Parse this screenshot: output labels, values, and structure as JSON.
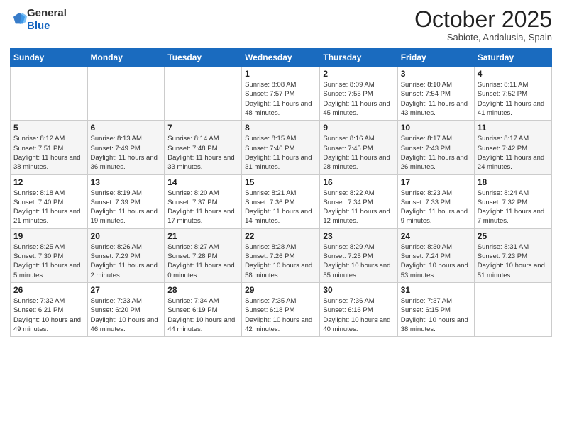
{
  "logo": {
    "general": "General",
    "blue": "Blue"
  },
  "title": "October 2025",
  "location": "Sabiote, Andalusia, Spain",
  "days_header": [
    "Sunday",
    "Monday",
    "Tuesday",
    "Wednesday",
    "Thursday",
    "Friday",
    "Saturday"
  ],
  "weeks": [
    [
      {
        "num": "",
        "info": ""
      },
      {
        "num": "",
        "info": ""
      },
      {
        "num": "",
        "info": ""
      },
      {
        "num": "1",
        "info": "Sunrise: 8:08 AM\nSunset: 7:57 PM\nDaylight: 11 hours\nand 48 minutes."
      },
      {
        "num": "2",
        "info": "Sunrise: 8:09 AM\nSunset: 7:55 PM\nDaylight: 11 hours\nand 45 minutes."
      },
      {
        "num": "3",
        "info": "Sunrise: 8:10 AM\nSunset: 7:54 PM\nDaylight: 11 hours\nand 43 minutes."
      },
      {
        "num": "4",
        "info": "Sunrise: 8:11 AM\nSunset: 7:52 PM\nDaylight: 11 hours\nand 41 minutes."
      }
    ],
    [
      {
        "num": "5",
        "info": "Sunrise: 8:12 AM\nSunset: 7:51 PM\nDaylight: 11 hours\nand 38 minutes."
      },
      {
        "num": "6",
        "info": "Sunrise: 8:13 AM\nSunset: 7:49 PM\nDaylight: 11 hours\nand 36 minutes."
      },
      {
        "num": "7",
        "info": "Sunrise: 8:14 AM\nSunset: 7:48 PM\nDaylight: 11 hours\nand 33 minutes."
      },
      {
        "num": "8",
        "info": "Sunrise: 8:15 AM\nSunset: 7:46 PM\nDaylight: 11 hours\nand 31 minutes."
      },
      {
        "num": "9",
        "info": "Sunrise: 8:16 AM\nSunset: 7:45 PM\nDaylight: 11 hours\nand 28 minutes."
      },
      {
        "num": "10",
        "info": "Sunrise: 8:17 AM\nSunset: 7:43 PM\nDaylight: 11 hours\nand 26 minutes."
      },
      {
        "num": "11",
        "info": "Sunrise: 8:17 AM\nSunset: 7:42 PM\nDaylight: 11 hours\nand 24 minutes."
      }
    ],
    [
      {
        "num": "12",
        "info": "Sunrise: 8:18 AM\nSunset: 7:40 PM\nDaylight: 11 hours\nand 21 minutes."
      },
      {
        "num": "13",
        "info": "Sunrise: 8:19 AM\nSunset: 7:39 PM\nDaylight: 11 hours\nand 19 minutes."
      },
      {
        "num": "14",
        "info": "Sunrise: 8:20 AM\nSunset: 7:37 PM\nDaylight: 11 hours\nand 17 minutes."
      },
      {
        "num": "15",
        "info": "Sunrise: 8:21 AM\nSunset: 7:36 PM\nDaylight: 11 hours\nand 14 minutes."
      },
      {
        "num": "16",
        "info": "Sunrise: 8:22 AM\nSunset: 7:34 PM\nDaylight: 11 hours\nand 12 minutes."
      },
      {
        "num": "17",
        "info": "Sunrise: 8:23 AM\nSunset: 7:33 PM\nDaylight: 11 hours\nand 9 minutes."
      },
      {
        "num": "18",
        "info": "Sunrise: 8:24 AM\nSunset: 7:32 PM\nDaylight: 11 hours\nand 7 minutes."
      }
    ],
    [
      {
        "num": "19",
        "info": "Sunrise: 8:25 AM\nSunset: 7:30 PM\nDaylight: 11 hours\nand 5 minutes."
      },
      {
        "num": "20",
        "info": "Sunrise: 8:26 AM\nSunset: 7:29 PM\nDaylight: 11 hours\nand 2 minutes."
      },
      {
        "num": "21",
        "info": "Sunrise: 8:27 AM\nSunset: 7:28 PM\nDaylight: 11 hours\nand 0 minutes."
      },
      {
        "num": "22",
        "info": "Sunrise: 8:28 AM\nSunset: 7:26 PM\nDaylight: 10 hours\nand 58 minutes."
      },
      {
        "num": "23",
        "info": "Sunrise: 8:29 AM\nSunset: 7:25 PM\nDaylight: 10 hours\nand 55 minutes."
      },
      {
        "num": "24",
        "info": "Sunrise: 8:30 AM\nSunset: 7:24 PM\nDaylight: 10 hours\nand 53 minutes."
      },
      {
        "num": "25",
        "info": "Sunrise: 8:31 AM\nSunset: 7:23 PM\nDaylight: 10 hours\nand 51 minutes."
      }
    ],
    [
      {
        "num": "26",
        "info": "Sunrise: 7:32 AM\nSunset: 6:21 PM\nDaylight: 10 hours\nand 49 minutes."
      },
      {
        "num": "27",
        "info": "Sunrise: 7:33 AM\nSunset: 6:20 PM\nDaylight: 10 hours\nand 46 minutes."
      },
      {
        "num": "28",
        "info": "Sunrise: 7:34 AM\nSunset: 6:19 PM\nDaylight: 10 hours\nand 44 minutes."
      },
      {
        "num": "29",
        "info": "Sunrise: 7:35 AM\nSunset: 6:18 PM\nDaylight: 10 hours\nand 42 minutes."
      },
      {
        "num": "30",
        "info": "Sunrise: 7:36 AM\nSunset: 6:16 PM\nDaylight: 10 hours\nand 40 minutes."
      },
      {
        "num": "31",
        "info": "Sunrise: 7:37 AM\nSunset: 6:15 PM\nDaylight: 10 hours\nand 38 minutes."
      },
      {
        "num": "",
        "info": ""
      }
    ]
  ]
}
